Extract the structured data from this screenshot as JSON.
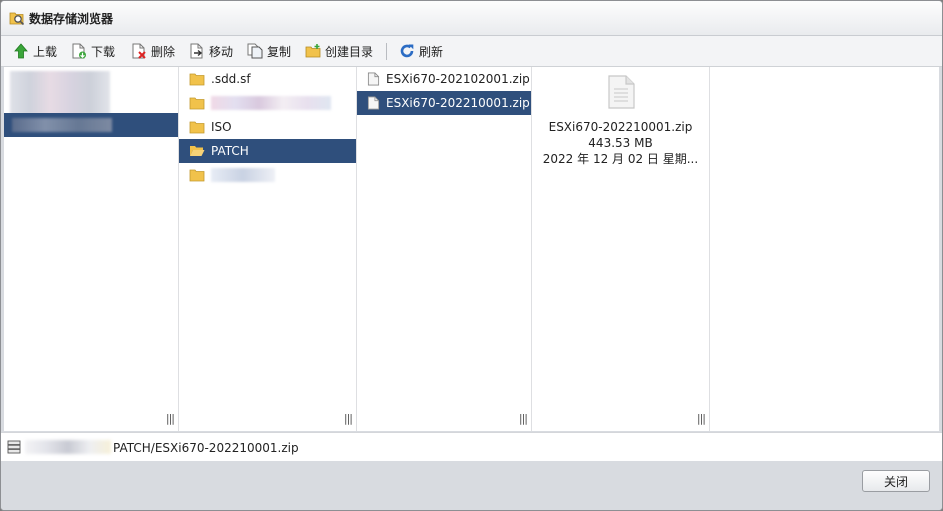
{
  "window": {
    "title": "数据存储浏览器"
  },
  "toolbar": {
    "upload": "上载",
    "download": "下载",
    "delete": "删除",
    "move": "移动",
    "copy": "复制",
    "create_dir": "创建目录",
    "refresh": "刷新"
  },
  "columns": {
    "folders": [
      ".sdd.sf",
      "ISO",
      "PATCH"
    ],
    "files": [
      "ESXi670-202102001.zip",
      "ESXi670-202210001.zip"
    ]
  },
  "detail": {
    "name": "ESXi670-202210001.zip",
    "size": "443.53 MB",
    "date": "2022 年 12 月 02 日 星期..."
  },
  "pathbar": {
    "path": "PATCH/ESXi670-202210001.zip"
  },
  "footer": {
    "close_label": "关闭"
  },
  "colors": {
    "selection": "#2f4f7c",
    "folder": "#f1c24b",
    "refresh": "#2b6cc4"
  }
}
